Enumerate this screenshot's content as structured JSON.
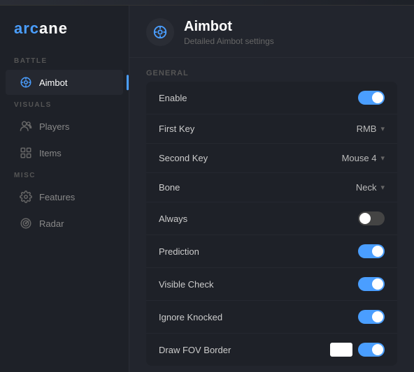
{
  "app": {
    "logo_prefix": "arc",
    "logo_suffix": "ane"
  },
  "sidebar": {
    "sections": [
      {
        "label": "BATTLE",
        "items": [
          {
            "id": "aimbot",
            "label": "Aimbot",
            "icon": "crosshair",
            "active": true
          }
        ]
      },
      {
        "label": "VISUALS",
        "items": [
          {
            "id": "players",
            "label": "Players",
            "icon": "users",
            "active": false
          },
          {
            "id": "items",
            "label": "Items",
            "icon": "grid",
            "active": false
          }
        ]
      },
      {
        "label": "MISC",
        "items": [
          {
            "id": "features",
            "label": "Features",
            "icon": "gear",
            "active": false
          },
          {
            "id": "radar",
            "label": "Radar",
            "icon": "radar",
            "active": false
          }
        ]
      }
    ]
  },
  "header": {
    "title": "Aimbot",
    "subtitle": "Detailed Aimbot settings"
  },
  "settings": {
    "section_label": "General",
    "rows": [
      {
        "id": "enable",
        "label": "Enable",
        "type": "toggle",
        "value": true
      },
      {
        "id": "first-key",
        "label": "First Key",
        "type": "dropdown",
        "value": "RMB"
      },
      {
        "id": "second-key",
        "label": "Second Key",
        "type": "dropdown",
        "value": "Mouse 4"
      },
      {
        "id": "bone",
        "label": "Bone",
        "type": "dropdown",
        "value": "Neck"
      },
      {
        "id": "always",
        "label": "Always",
        "type": "toggle",
        "value": false
      },
      {
        "id": "prediction",
        "label": "Prediction",
        "type": "toggle",
        "value": true
      },
      {
        "id": "visible-check",
        "label": "Visible Check",
        "type": "toggle",
        "value": true
      },
      {
        "id": "ignore-knocked",
        "label": "Ignore Knocked",
        "type": "toggle",
        "value": true
      },
      {
        "id": "draw-fov-border",
        "label": "Draw FOV Border",
        "type": "toggle-with-box",
        "value": true
      }
    ]
  }
}
